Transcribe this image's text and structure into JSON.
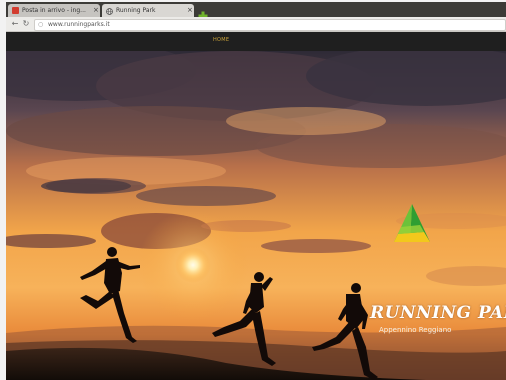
{
  "browser": {
    "tabs": [
      {
        "title": "Posta in arrivo - ing...",
        "favicon": "mail-favicon",
        "active": false
      },
      {
        "title": "Running Park",
        "favicon": "globe-favicon",
        "active": true
      }
    ],
    "close_glyph": "×",
    "new_tab_icon": "new-tab-icon",
    "url": "www.runningparks.it",
    "colors": {
      "tabbar": "#3c3b37",
      "active_tab": "#d9d7d3",
      "new_tab_green": "#6fb22b"
    }
  },
  "page": {
    "nav": {
      "home_label": "HOME"
    },
    "hero": {
      "brand_title": "RUNNING PARK",
      "brand_subtitle": "Appennino Reggiano",
      "logo_icon": "triangle-logo-icon"
    },
    "colors": {
      "nav_bg": "#1f1f1f",
      "nav_home": "#c9a23a",
      "sky_top": "#2e2a36",
      "sky_glow": "#f7a43a",
      "sun": "#fff6d6",
      "logo_green": "#2f9e32",
      "logo_yellow": "#f2c81c"
    }
  }
}
